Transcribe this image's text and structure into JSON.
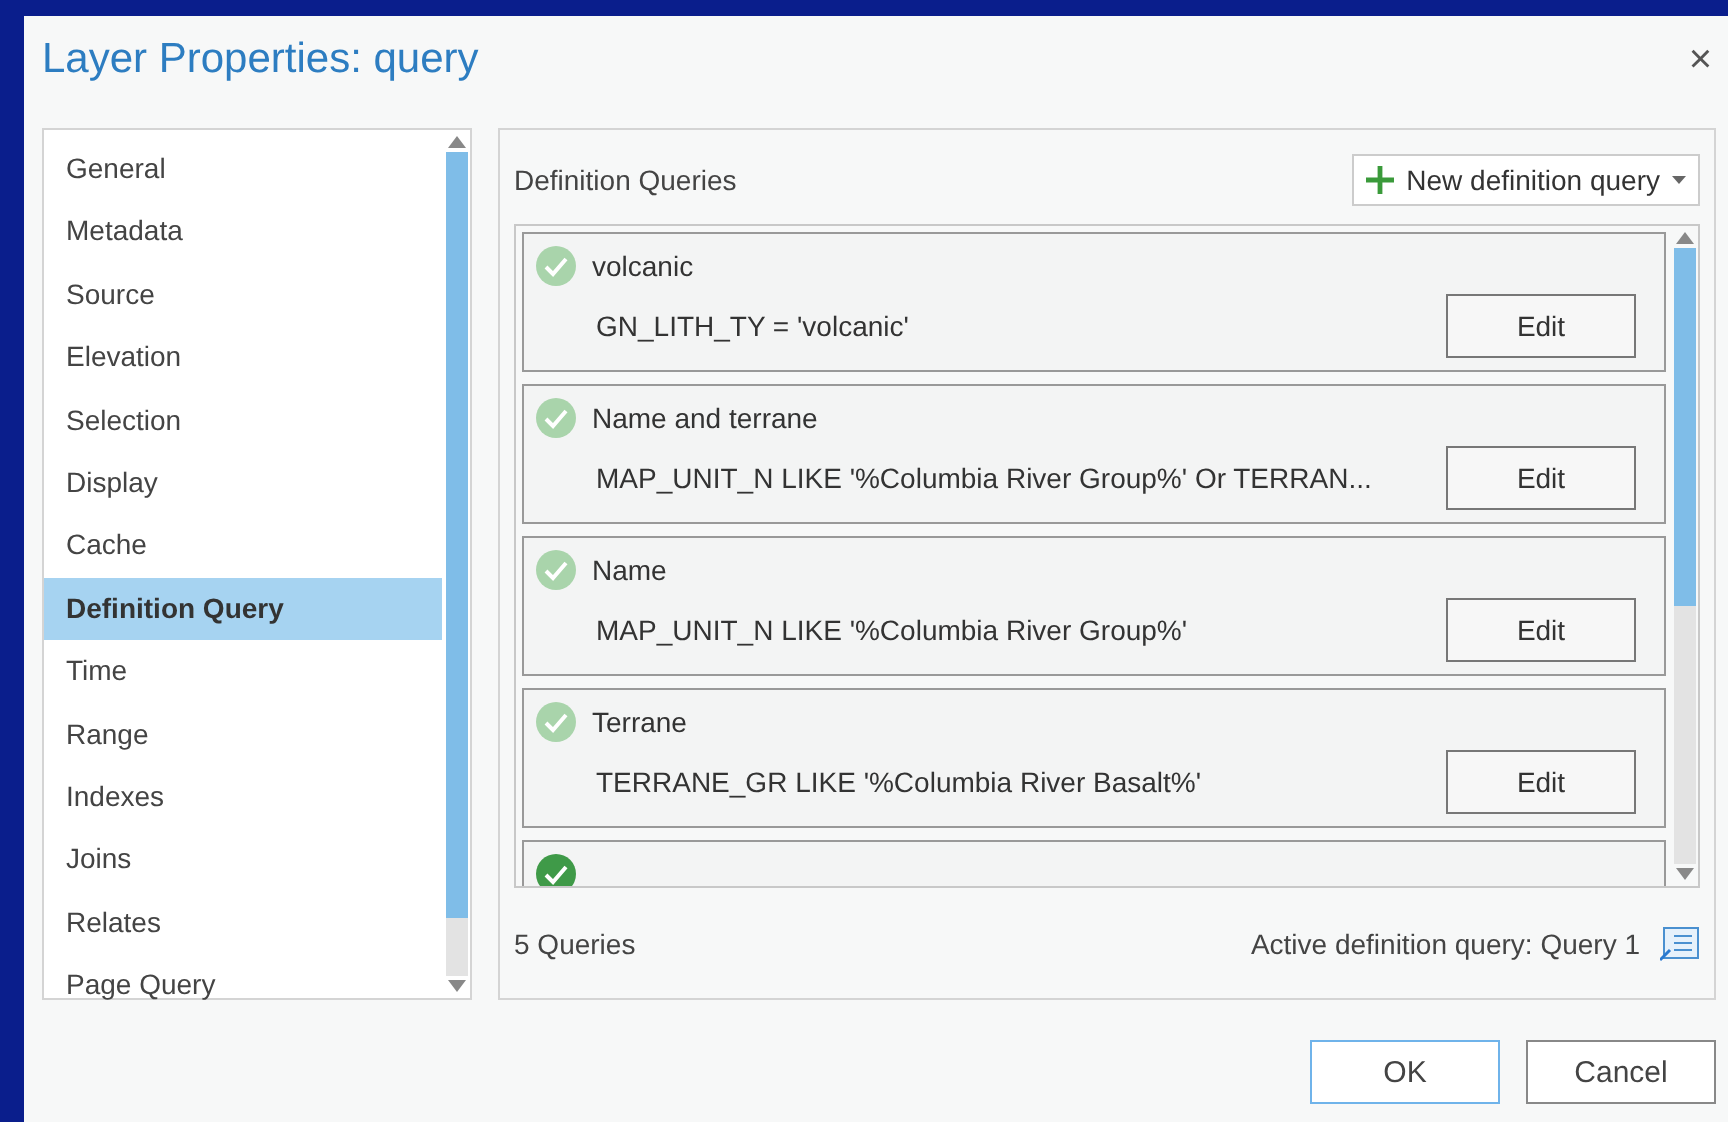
{
  "window": {
    "title": "Layer Properties: query",
    "close": "×"
  },
  "sidebar": {
    "items": [
      {
        "label": "General",
        "selected": false
      },
      {
        "label": "Metadata",
        "selected": false
      },
      {
        "label": "Source",
        "selected": false
      },
      {
        "label": "Elevation",
        "selected": false
      },
      {
        "label": "Selection",
        "selected": false
      },
      {
        "label": "Display",
        "selected": false
      },
      {
        "label": "Cache",
        "selected": false
      },
      {
        "label": "Definition Query",
        "selected": true
      },
      {
        "label": "Time",
        "selected": false
      },
      {
        "label": "Range",
        "selected": false
      },
      {
        "label": "Indexes",
        "selected": false
      },
      {
        "label": "Joins",
        "selected": false
      },
      {
        "label": "Relates",
        "selected": false
      },
      {
        "label": "Page Query",
        "selected": false
      }
    ]
  },
  "panel": {
    "heading": "Definition Queries",
    "new_button": "New definition query",
    "queries": [
      {
        "name": "volcanic",
        "clause": "GN_LITH_TY = 'volcanic'",
        "button": "Edit",
        "active": false
      },
      {
        "name": "Name and terrane",
        "clause": "MAP_UNIT_N LIKE '%Columbia River Group%' Or TERRAN...",
        "button": "Edit",
        "active": false
      },
      {
        "name": "Name",
        "clause": "MAP_UNIT_N LIKE '%Columbia River Group%'",
        "button": "Edit",
        "active": false
      },
      {
        "name": "Terrane",
        "clause": "TERRANE_GR LIKE '%Columbia River Basalt%'",
        "button": "Edit",
        "active": false
      },
      {
        "active": true
      }
    ],
    "count": "5 Queries",
    "active_query": "Active definition query: Query 1"
  },
  "buttons": [
    "OK",
    "Cancel"
  ]
}
